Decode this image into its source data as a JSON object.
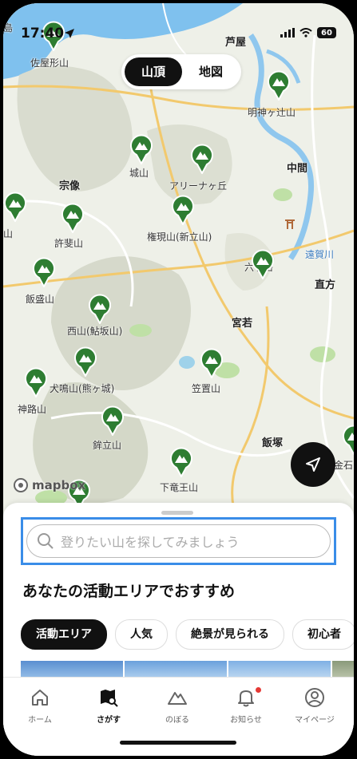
{
  "status_bar": {
    "time": "17:40",
    "battery": "60"
  },
  "map_toggle": {
    "summit_label": "山頂",
    "map_label": "地図"
  },
  "map": {
    "place_labels": [
      "佐屋形山",
      "宗像",
      "城山",
      "アリーナヶ丘",
      "芦屋",
      "明神ヶ辻山",
      "中間",
      "許斐山",
      "権現山(新立山)",
      "遠賀川",
      "飯盛山",
      "六ヶ岳",
      "直方",
      "西山(鮎坂山)",
      "宮若",
      "犬鳴山(熊ヶ城)",
      "笠置山",
      "神路山",
      "鉾立山",
      "飯塚",
      "下竜王山",
      "金石",
      "山",
      "島"
    ],
    "attribution": "mapbox"
  },
  "sheet": {
    "search_placeholder": "登りたい山を探してみましょう",
    "heading": "あなたの活動エリアでおすすめ",
    "chips": [
      "活動エリア",
      "人気",
      "絶景が見られる",
      "初心者"
    ]
  },
  "tabs": [
    "ホーム",
    "さがす",
    "のぼる",
    "お知らせ",
    "マイページ"
  ],
  "colors": {
    "accent": "#3a8de8",
    "pin": "#2e7d32",
    "notification": "#e53935"
  }
}
